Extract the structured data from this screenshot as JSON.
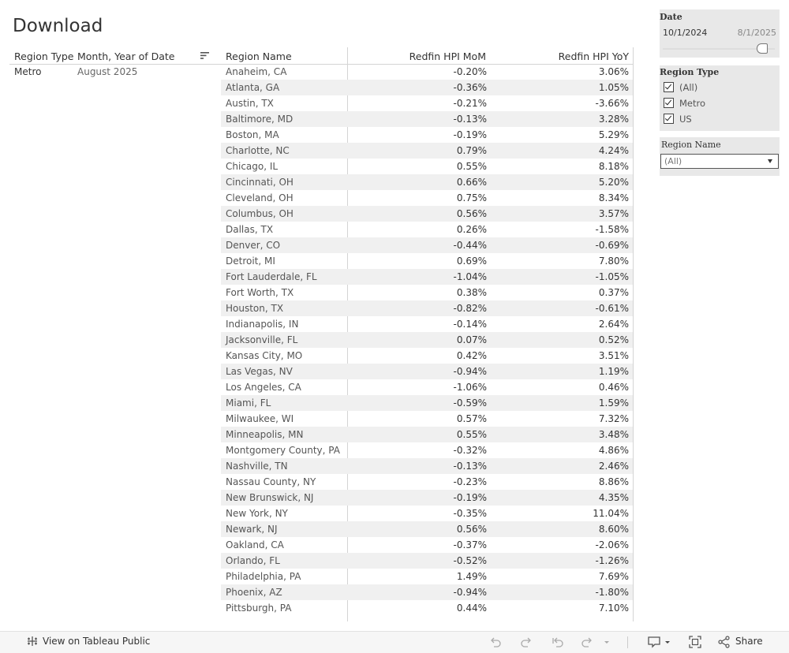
{
  "page": {
    "title": "Download"
  },
  "table": {
    "headers": {
      "region_type": "Region Type",
      "month_year": "Month, Year of Date",
      "region_name": "Region Name",
      "mom": "Redfin HPI MoM",
      "yoy": "Redfin HPI YoY"
    },
    "group": {
      "region_type": "Metro",
      "month_year": "August 2025"
    },
    "rows": [
      {
        "name": "Anaheim, CA",
        "mom": "-0.20%",
        "yoy": "3.06%"
      },
      {
        "name": "Atlanta, GA",
        "mom": "-0.36%",
        "yoy": "1.05%"
      },
      {
        "name": "Austin, TX",
        "mom": "-0.21%",
        "yoy": "-3.66%"
      },
      {
        "name": "Baltimore, MD",
        "mom": "-0.13%",
        "yoy": "3.28%"
      },
      {
        "name": "Boston, MA",
        "mom": "-0.19%",
        "yoy": "5.29%"
      },
      {
        "name": "Charlotte, NC",
        "mom": "0.79%",
        "yoy": "4.24%"
      },
      {
        "name": "Chicago, IL",
        "mom": "0.55%",
        "yoy": "8.18%"
      },
      {
        "name": "Cincinnati, OH",
        "mom": "0.66%",
        "yoy": "5.20%"
      },
      {
        "name": "Cleveland, OH",
        "mom": "0.75%",
        "yoy": "8.34%"
      },
      {
        "name": "Columbus, OH",
        "mom": "0.56%",
        "yoy": "3.57%"
      },
      {
        "name": "Dallas, TX",
        "mom": "0.26%",
        "yoy": "-1.58%"
      },
      {
        "name": "Denver, CO",
        "mom": "-0.44%",
        "yoy": "-0.69%"
      },
      {
        "name": "Detroit, MI",
        "mom": "0.69%",
        "yoy": "7.80%"
      },
      {
        "name": "Fort Lauderdale, FL",
        "mom": "-1.04%",
        "yoy": "-1.05%"
      },
      {
        "name": "Fort Worth, TX",
        "mom": "0.38%",
        "yoy": "0.37%"
      },
      {
        "name": "Houston, TX",
        "mom": "-0.82%",
        "yoy": "-0.61%"
      },
      {
        "name": "Indianapolis, IN",
        "mom": "-0.14%",
        "yoy": "2.64%"
      },
      {
        "name": "Jacksonville, FL",
        "mom": "0.07%",
        "yoy": "0.52%"
      },
      {
        "name": "Kansas City, MO",
        "mom": "0.42%",
        "yoy": "3.51%"
      },
      {
        "name": "Las Vegas, NV",
        "mom": "-0.94%",
        "yoy": "1.19%"
      },
      {
        "name": "Los Angeles, CA",
        "mom": "-1.06%",
        "yoy": "0.46%"
      },
      {
        "name": "Miami, FL",
        "mom": "-0.59%",
        "yoy": "1.59%"
      },
      {
        "name": "Milwaukee, WI",
        "mom": "0.57%",
        "yoy": "7.32%"
      },
      {
        "name": "Minneapolis, MN",
        "mom": "0.55%",
        "yoy": "3.48%"
      },
      {
        "name": "Montgomery County, PA",
        "mom": "-0.32%",
        "yoy": "4.86%"
      },
      {
        "name": "Nashville, TN",
        "mom": "-0.13%",
        "yoy": "2.46%"
      },
      {
        "name": "Nassau County, NY",
        "mom": "-0.23%",
        "yoy": "8.86%"
      },
      {
        "name": "New Brunswick, NJ",
        "mom": "-0.19%",
        "yoy": "4.35%"
      },
      {
        "name": "New York, NY",
        "mom": "-0.35%",
        "yoy": "11.04%"
      },
      {
        "name": "Newark, NJ",
        "mom": "0.56%",
        "yoy": "8.60%"
      },
      {
        "name": "Oakland, CA",
        "mom": "-0.37%",
        "yoy": "-2.06%"
      },
      {
        "name": "Orlando, FL",
        "mom": "-0.52%",
        "yoy": "-1.26%"
      },
      {
        "name": "Philadelphia, PA",
        "mom": "1.49%",
        "yoy": "7.69%"
      },
      {
        "name": "Phoenix, AZ",
        "mom": "-0.94%",
        "yoy": "-1.80%"
      },
      {
        "name": "Pittsburgh, PA",
        "mom": "0.44%",
        "yoy": "7.10%"
      }
    ]
  },
  "filters": {
    "date": {
      "title": "Date",
      "start": "10/1/2024",
      "end": "8/1/2025"
    },
    "region_type": {
      "title": "Region Type",
      "options": [
        "(All)",
        "Metro",
        "US"
      ]
    },
    "region_name": {
      "title": "Region Name",
      "selected": "(All)"
    }
  },
  "footer": {
    "view_label": "View on Tableau Public",
    "share_label": "Share"
  },
  "colors": {
    "row_alt": "#f0f0f0",
    "panel_bg": "#e8e8e8"
  },
  "icons": {
    "tableau": "tableau-logo-icon",
    "undo": "undo-icon",
    "redo": "redo-icon",
    "revert": "revert-icon",
    "refresh": "refresh-icon",
    "comment": "comment-icon",
    "fullscreen": "fullscreen-icon",
    "share": "share-icon",
    "sort": "sort-icon"
  }
}
